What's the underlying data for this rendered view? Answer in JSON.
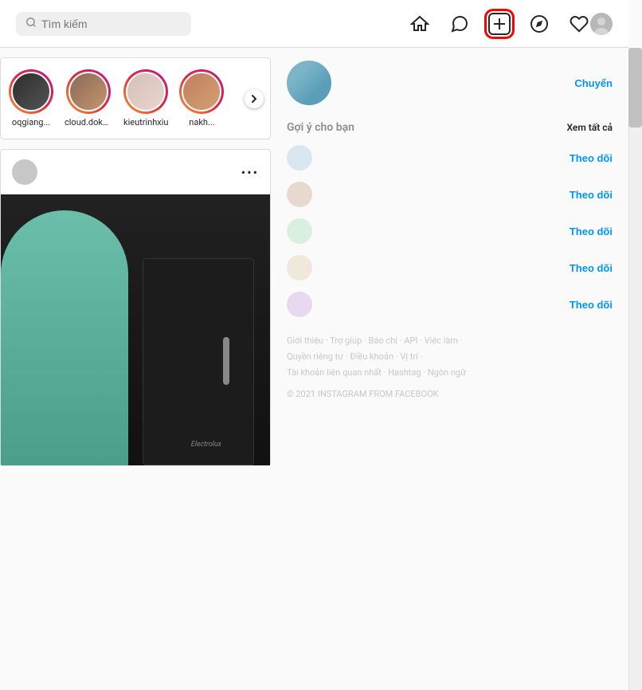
{
  "header": {
    "search_placeholder": "Tìm kiếm",
    "nav": {
      "home_label": "home",
      "messenger_label": "messenger",
      "create_label": "create",
      "explore_label": "explore",
      "likes_label": "likes",
      "profile_label": "profile"
    }
  },
  "stories": {
    "items": [
      {
        "username": "oqgiang...",
        "has_ring": true
      },
      {
        "username": "cloud.dokh...",
        "has_ring": true
      },
      {
        "username": "kieutrinhxiu",
        "has_ring": true
      },
      {
        "username": "nakh...",
        "has_ring": true
      }
    ],
    "next_button_label": "next"
  },
  "post": {
    "username": "",
    "more_label": "•••",
    "appliance_brand": "Electrolux"
  },
  "sidebar": {
    "switch_label": "Chuyển",
    "suggestions": {
      "title": "Gợi ý cho bạn",
      "see_all_label": "Xem tất cả",
      "items": [
        {
          "username": "",
          "sub": "",
          "follow_label": "Theo dõi"
        },
        {
          "username": "",
          "sub": "",
          "follow_label": "Theo dõi"
        },
        {
          "username": "",
          "sub": "",
          "follow_label": "Theo dõi"
        },
        {
          "username": "",
          "sub": "",
          "follow_label": "Theo dõi"
        },
        {
          "username": "",
          "sub": "",
          "follow_label": "Theo dõi"
        }
      ]
    }
  },
  "footer": {
    "links": [
      "Giới thiệu",
      "Trợ giúp",
      "Báo chí",
      "API",
      "Việc làm",
      "Quyền riêng tư",
      "Điều khoản",
      "Vị trí",
      "Tài khoản liên quan nhất",
      "Hashtag",
      "Ngôn ngữ"
    ],
    "copyright": "© 2021 INSTAGRAM FROM FACEBOOK"
  }
}
